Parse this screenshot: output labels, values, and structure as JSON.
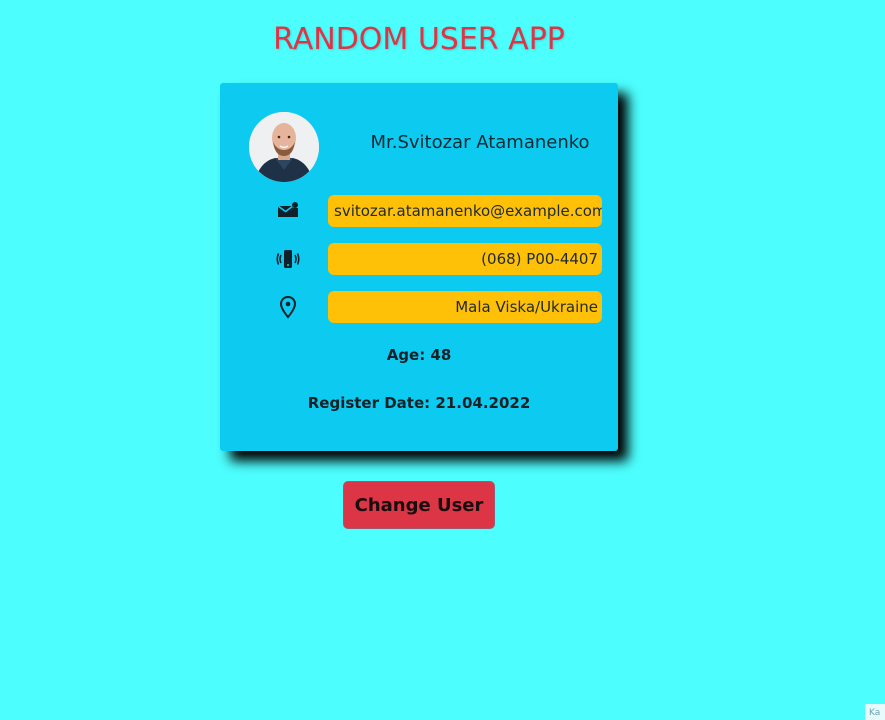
{
  "app": {
    "title": "RANDOM USER APP"
  },
  "user": {
    "name": "Mr.Svitozar Atamanenko",
    "email": "svitozar.atamanenko@example.com",
    "phone": "(068) P00-4407",
    "location": "Mala Viska/Ukraine",
    "age_text": "Age: 48",
    "register_text": "Register Date: 21.04.2022"
  },
  "icons": {
    "avatar": "avatar-photo",
    "email": "mail-icon",
    "phone": "phone-vibrate-icon",
    "location": "location-pin-icon"
  },
  "actions": {
    "change_user_label": "Change User"
  },
  "corner": {
    "label": "Ka"
  },
  "colors": {
    "background": "#4dfefe",
    "title": "#dc3545",
    "card": "#0dcaf0",
    "pill": "#ffc107",
    "button": "#dc3545"
  }
}
